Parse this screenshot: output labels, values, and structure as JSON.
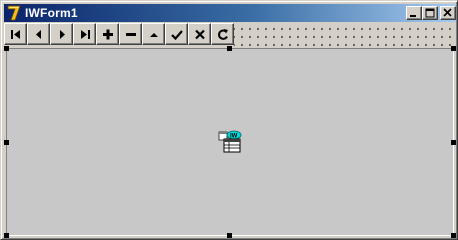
{
  "window": {
    "title": "IWForm1",
    "title_bar_gradient": [
      "#0a246a",
      "#a6caf0"
    ],
    "icons": {
      "app": "delphi-7-icon",
      "minimize": "minimize-icon",
      "maximize": "maximize-icon",
      "close": "close-icon"
    }
  },
  "navigator": {
    "buttons": [
      {
        "name": "first",
        "icon": "first-record-icon"
      },
      {
        "name": "prior",
        "icon": "prior-record-icon"
      },
      {
        "name": "next",
        "icon": "next-record-icon"
      },
      {
        "name": "last",
        "icon": "last-record-icon"
      },
      {
        "name": "insert",
        "icon": "plus-icon"
      },
      {
        "name": "delete",
        "icon": "minus-icon"
      },
      {
        "name": "edit",
        "icon": "edit-caret-icon"
      },
      {
        "name": "post",
        "icon": "checkmark-icon"
      },
      {
        "name": "cancel",
        "icon": "x-icon"
      },
      {
        "name": "refresh",
        "icon": "refresh-icon"
      }
    ]
  },
  "form_panel": {
    "background": "#c8c8c8",
    "component": {
      "icon": "iw-component-icon",
      "badge": "IW"
    }
  }
}
